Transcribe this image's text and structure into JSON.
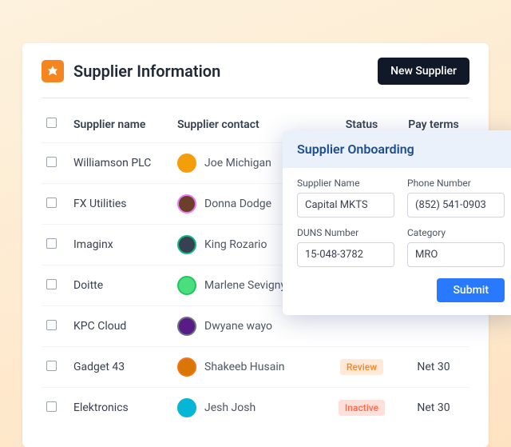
{
  "header": {
    "title": "Supplier Information",
    "new_supplier_label": "New Supplier"
  },
  "columns": {
    "name": "Supplier name",
    "contact": "Supplier contact",
    "status": "Status",
    "pay": "Pay terms"
  },
  "rows": [
    {
      "name": "Williamson PLC",
      "contact": "Joe Michigan",
      "avatar_bg": "#f59e0b",
      "avatar_bd": "#f59e0b",
      "status": "",
      "pay": ""
    },
    {
      "name": "FX Utilities",
      "contact": "Donna Dodge",
      "avatar_bg": "#6b3f2a",
      "avatar_bd": "#e879f9",
      "status": "",
      "pay": ""
    },
    {
      "name": "Imaginx",
      "contact": "King Rozario",
      "avatar_bg": "#374151",
      "avatar_bd": "#10b981",
      "status": "",
      "pay": ""
    },
    {
      "name": "Doitte",
      "contact": "Marlene Sevigny",
      "avatar_bg": "#4ade80",
      "avatar_bd": "#22c55e",
      "status": "",
      "pay": ""
    },
    {
      "name": "KPC Cloud",
      "contact": "Dwyane wayo",
      "avatar_bg": "#581c87",
      "avatar_bd": "#6b7280",
      "status": "",
      "pay": ""
    },
    {
      "name": "Gadget 43",
      "contact": "Shakeeb Husain",
      "avatar_bg": "#d97706",
      "avatar_bd": "#f97316",
      "status": "Review",
      "status_cls": "badge-review",
      "pay": "Net 30"
    },
    {
      "name": "Elektronics",
      "contact": "Jesh Josh",
      "avatar_bg": "#06b6d4",
      "avatar_bd": "#06b6d4",
      "status": "Inactive",
      "status_cls": "badge-inactive",
      "pay": "Net 30"
    }
  ],
  "panel": {
    "title": "Supplier Onboarding",
    "fields": {
      "supplier_name": {
        "label": "Supplier Name",
        "value": "Capital MKTS"
      },
      "phone": {
        "label": "Phone Number",
        "value": "(852) 541-0903"
      },
      "duns": {
        "label": "DUNS Number",
        "value": "15-048-3782"
      },
      "category": {
        "label": "Category",
        "value": "MRO"
      }
    },
    "submit_label": "Submit"
  }
}
